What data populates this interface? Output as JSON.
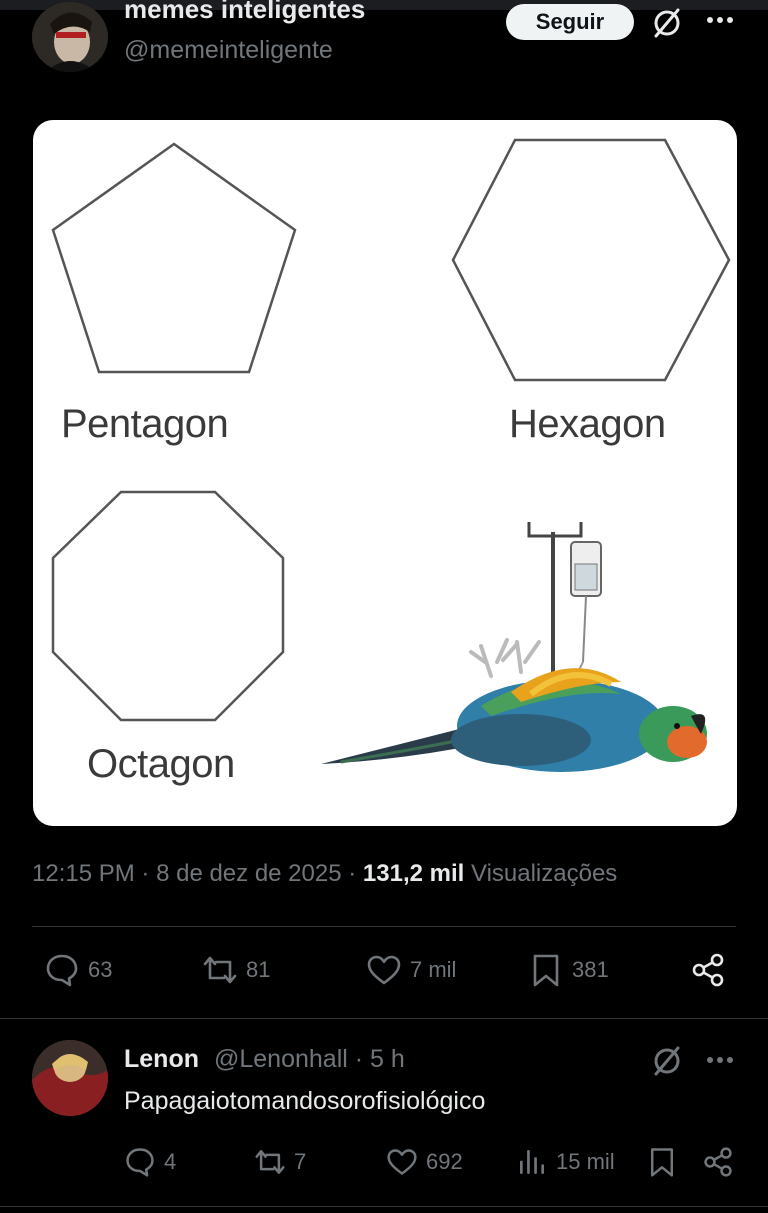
{
  "post": {
    "author_name": "memes inteligentes",
    "author_handle": "@memeinteligente",
    "follow_label": "Seguir",
    "image": {
      "labels": [
        "Pentagon",
        "Hexagon",
        "Octagon"
      ]
    },
    "meta": {
      "time": "12:15 PM",
      "date": "8 de dez de 2025",
      "views_count": "131,2 mil",
      "views_label": "Visualizações"
    },
    "actions": {
      "replies": "63",
      "reposts": "81",
      "likes": "7 mil",
      "bookmarks": "381"
    }
  },
  "reply": {
    "name": "Lenon",
    "handle_time": "@Lenonhall · 5 h",
    "text": "Papagaiotomandosorofisiológico",
    "actions": {
      "replies": "4",
      "reposts": "7",
      "likes": "692",
      "views": "15 mil"
    }
  },
  "icons": [
    "comment-icon",
    "repost-icon",
    "heart-icon",
    "bookmark-icon",
    "share-icon",
    "grok-icon",
    "more-icon",
    "views-icon"
  ],
  "colors": {
    "background": "#000000",
    "text": "#e7e9ea",
    "muted": "#71767b",
    "divider": "#2f3336",
    "follow_bg": "#eff3f4"
  }
}
